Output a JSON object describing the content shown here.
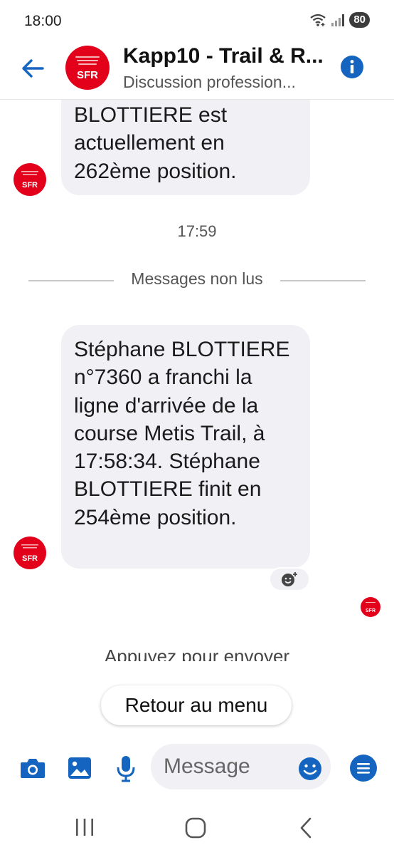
{
  "status": {
    "time": "18:00",
    "battery": "80"
  },
  "header": {
    "title": "Kapp10 - Trail & R...",
    "subtitle": "Discussion profession...",
    "avatar_label": "SFR"
  },
  "messages": {
    "first_partial": "BLOTTIERE est actuellement en 262ème position.",
    "timestamp": "17:59",
    "unread_label": "Messages non lus",
    "second": "Stéphane BLOTTIERE n°7360 a franchi la ligne d'arrivée de la course Metis Trail, à 17:58:34. Stéphane BLOTTIERE finit en 254ème position."
  },
  "hint": "Appuyez pour envoyer",
  "quick_reply": "Retour au menu",
  "composer": {
    "placeholder": "Message"
  },
  "colors": {
    "accent": "#1565c0",
    "sfr_red": "#e2001a",
    "bubble": "#f0f0f5"
  }
}
